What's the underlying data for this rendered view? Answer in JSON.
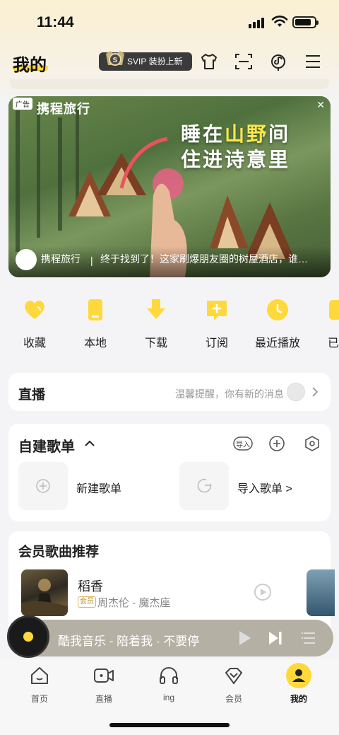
{
  "status_bar": {
    "time": "11:44"
  },
  "header": {
    "title": "我的",
    "svip_badge": "SVIP 装扮上新",
    "accent_color": "#ffd93b"
  },
  "ad": {
    "label": "广告",
    "brand": "携程旅行",
    "headline_line1_a": "睡在",
    "headline_line1_b": "山野",
    "headline_line1_c": "间",
    "headline_line2": "住进诗意里",
    "footer_brand": "携程旅行",
    "footer_separator": "|",
    "footer_text": "终于找到了！这家刷爆朋友圈的树屋酒店，谁…"
  },
  "quick_actions": [
    {
      "label": "收藏",
      "icon": "heart-icon"
    },
    {
      "label": "本地",
      "icon": "phone-icon"
    },
    {
      "label": "下载",
      "icon": "download-icon"
    },
    {
      "label": "订阅",
      "icon": "subscribe-icon"
    },
    {
      "label": "最近播放",
      "icon": "clock-icon"
    },
    {
      "label": "已",
      "icon": "check-icon"
    }
  ],
  "live": {
    "title": "直播",
    "hint": "温馨提醒，你有新的消息"
  },
  "playlists": {
    "title": "自建歌单",
    "import_label": "导入",
    "items": [
      {
        "label": "新建歌单"
      },
      {
        "label": "导入歌单 >"
      }
    ]
  },
  "recommend": {
    "title": "会员歌曲推荐",
    "song": {
      "name": "稻香",
      "vip_tag": "会员",
      "artist": "周杰伦 - 魔杰座"
    }
  },
  "mini_player": {
    "text": "酷我音乐 - 陪着我 · 不要停"
  },
  "tabbar": {
    "items": [
      {
        "label": "首页",
        "icon": "home-icon"
      },
      {
        "label": "直播",
        "icon": "video-icon"
      },
      {
        "label": "ing",
        "icon": "headphones-icon"
      },
      {
        "label": "会员",
        "icon": "diamond-icon"
      },
      {
        "label": "我的",
        "icon": "profile-icon"
      }
    ]
  }
}
